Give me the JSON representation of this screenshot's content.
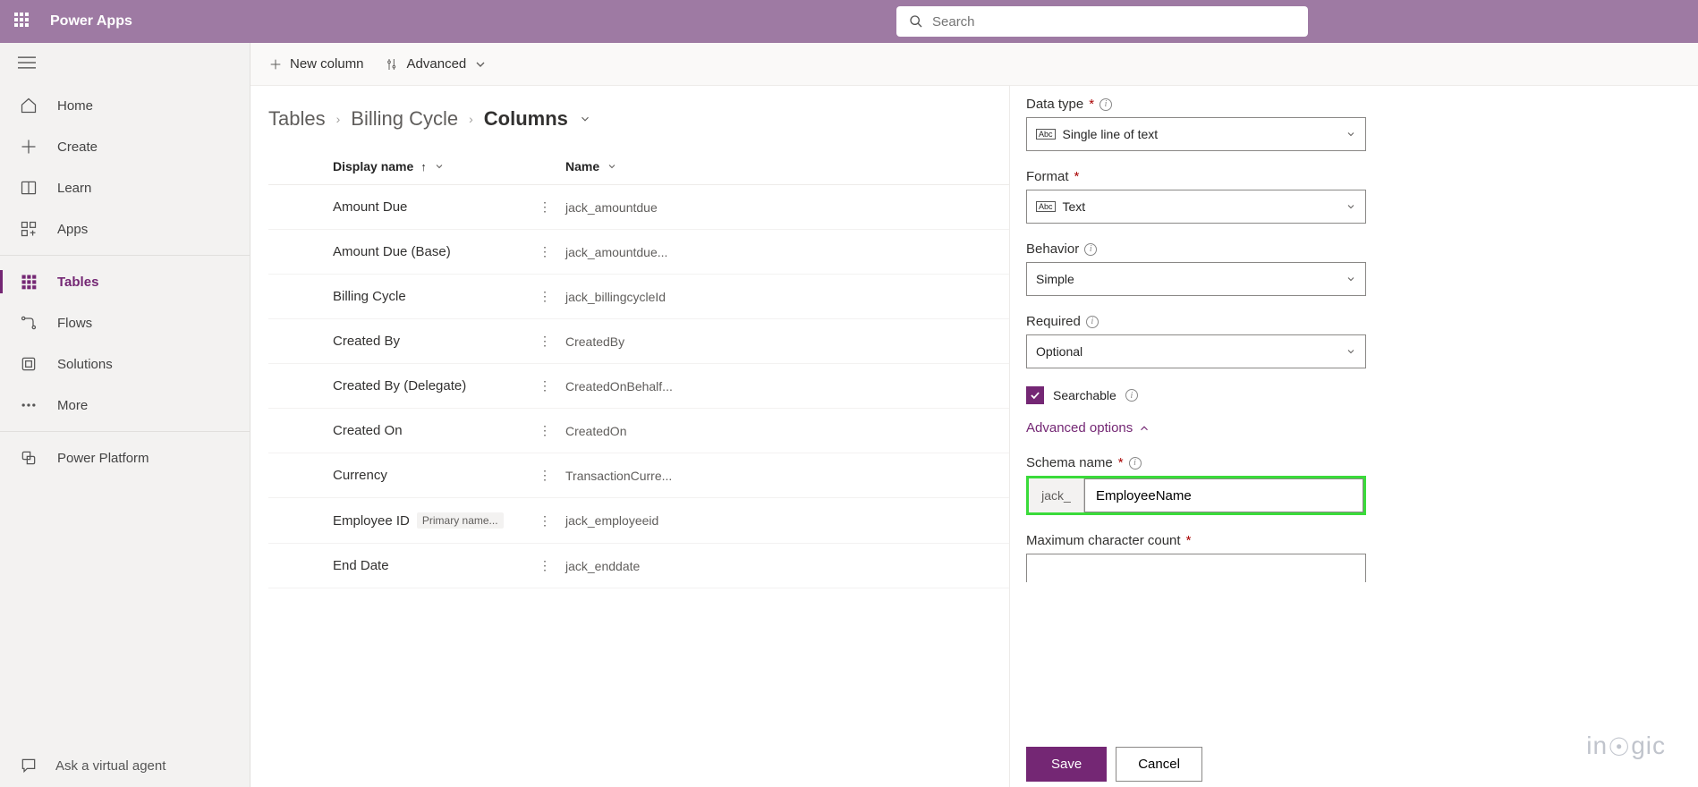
{
  "header": {
    "brand": "Power Apps",
    "search_placeholder": "Search"
  },
  "sidebar": {
    "items": [
      {
        "label": "Home",
        "icon": "home"
      },
      {
        "label": "Create",
        "icon": "plus"
      },
      {
        "label": "Learn",
        "icon": "book"
      },
      {
        "label": "Apps",
        "icon": "apps"
      },
      {
        "label": "Tables",
        "icon": "grid",
        "active": true
      },
      {
        "label": "Flows",
        "icon": "flow"
      },
      {
        "label": "Solutions",
        "icon": "solutions"
      },
      {
        "label": "More",
        "icon": "more"
      }
    ],
    "platform_label": "Power Platform",
    "ask_label": "Ask a virtual agent"
  },
  "toolbar": {
    "new_column": "New column",
    "advanced": "Advanced"
  },
  "breadcrumb": {
    "items": [
      "Tables",
      "Billing Cycle",
      "Columns"
    ]
  },
  "table": {
    "headers": {
      "display": "Display name",
      "name": "Name"
    },
    "rows": [
      {
        "display": "Amount Due",
        "name": "jack_amountdue"
      },
      {
        "display": "Amount Due (Base)",
        "name": "jack_amountdue..."
      },
      {
        "display": "Billing Cycle",
        "name": "jack_billingcycleId"
      },
      {
        "display": "Created By",
        "name": "CreatedBy"
      },
      {
        "display": "Created By (Delegate)",
        "name": "CreatedOnBehalf..."
      },
      {
        "display": "Created On",
        "name": "CreatedOn"
      },
      {
        "display": "Currency",
        "name": "TransactionCurre..."
      },
      {
        "display": "Employee ID",
        "name": "jack_employeeid",
        "primary": true
      },
      {
        "display": "End Date",
        "name": "jack_enddate"
      }
    ],
    "primary_badge": "Primary name..."
  },
  "panel": {
    "data_type": {
      "label": "Data type",
      "value": "Single line of text"
    },
    "format": {
      "label": "Format",
      "value": "Text"
    },
    "behavior": {
      "label": "Behavior",
      "value": "Simple"
    },
    "required": {
      "label": "Required",
      "value": "Optional"
    },
    "searchable": "Searchable",
    "advanced_options": "Advanced options",
    "schema": {
      "label": "Schema name",
      "prefix": "jack_",
      "value": "EmployeeName"
    },
    "max_count": {
      "label": "Maximum character count"
    },
    "save": "Save",
    "cancel": "Cancel"
  },
  "watermark": "inogic"
}
